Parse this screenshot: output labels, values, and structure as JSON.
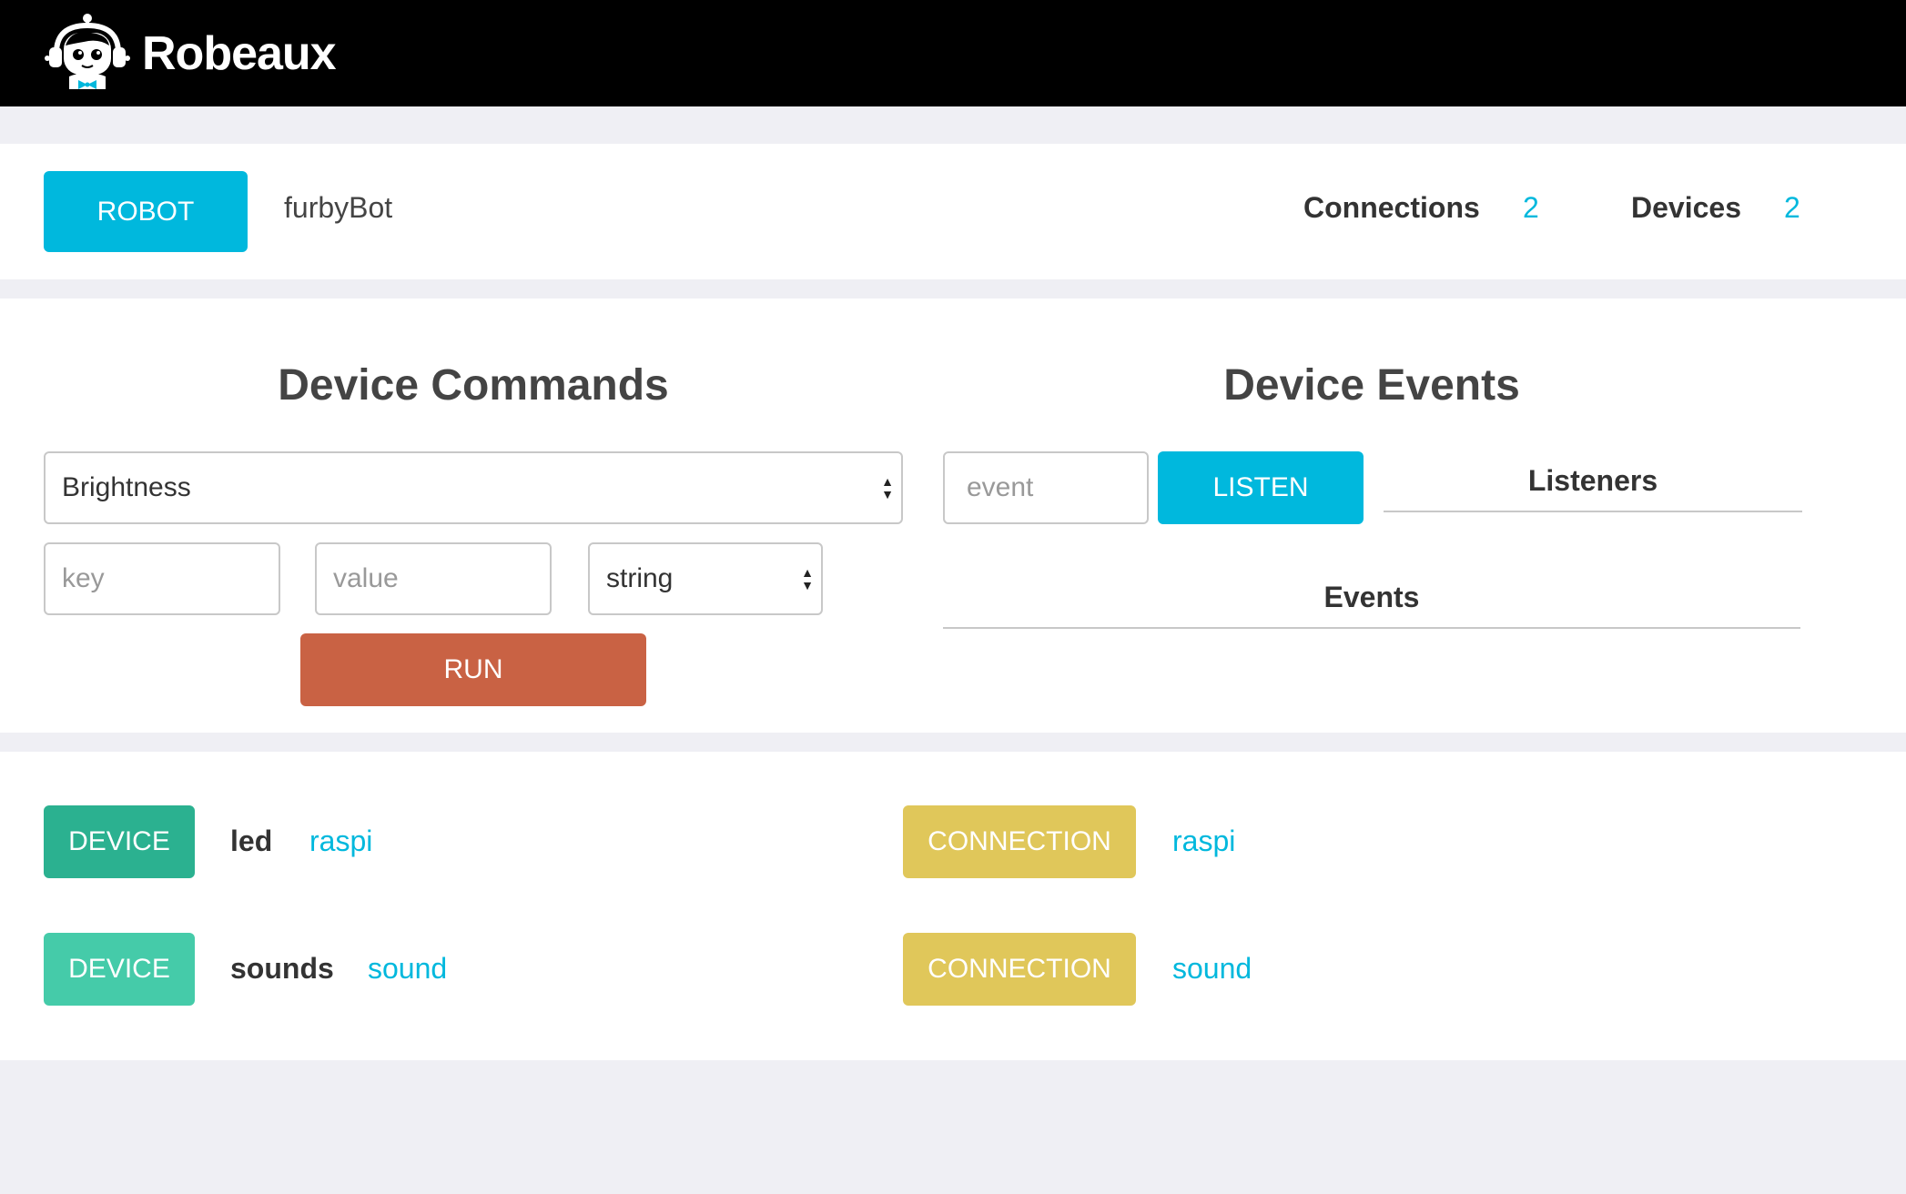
{
  "app": {
    "name": "Robeaux"
  },
  "robot": {
    "badge": "ROBOT",
    "name": "furbyBot",
    "connections_label": "Connections",
    "connections_count": "2",
    "devices_label": "Devices",
    "devices_count": "2"
  },
  "commands": {
    "title": "Device Commands",
    "command_selected": "Brightness",
    "key_placeholder": "key",
    "value_placeholder": "value",
    "type_selected": "string",
    "run_label": "RUN"
  },
  "events": {
    "title": "Device Events",
    "event_placeholder": "event",
    "listen_label": "LISTEN",
    "listeners_label": "Listeners",
    "events_label": "Events"
  },
  "devices": [
    {
      "badge": "DEVICE",
      "name": "led",
      "connection": "raspi"
    },
    {
      "badge": "DEVICE",
      "name": "sounds",
      "connection": "sound"
    }
  ],
  "connections": [
    {
      "badge": "CONNECTION",
      "name": "raspi"
    },
    {
      "badge": "CONNECTION",
      "name": "sound"
    }
  ],
  "colors": {
    "accent": "#00b8dd",
    "run": "#c96244",
    "device_primary": "#2bb190",
    "device_secondary": "#45cba9",
    "connection": "#e0c75a"
  }
}
